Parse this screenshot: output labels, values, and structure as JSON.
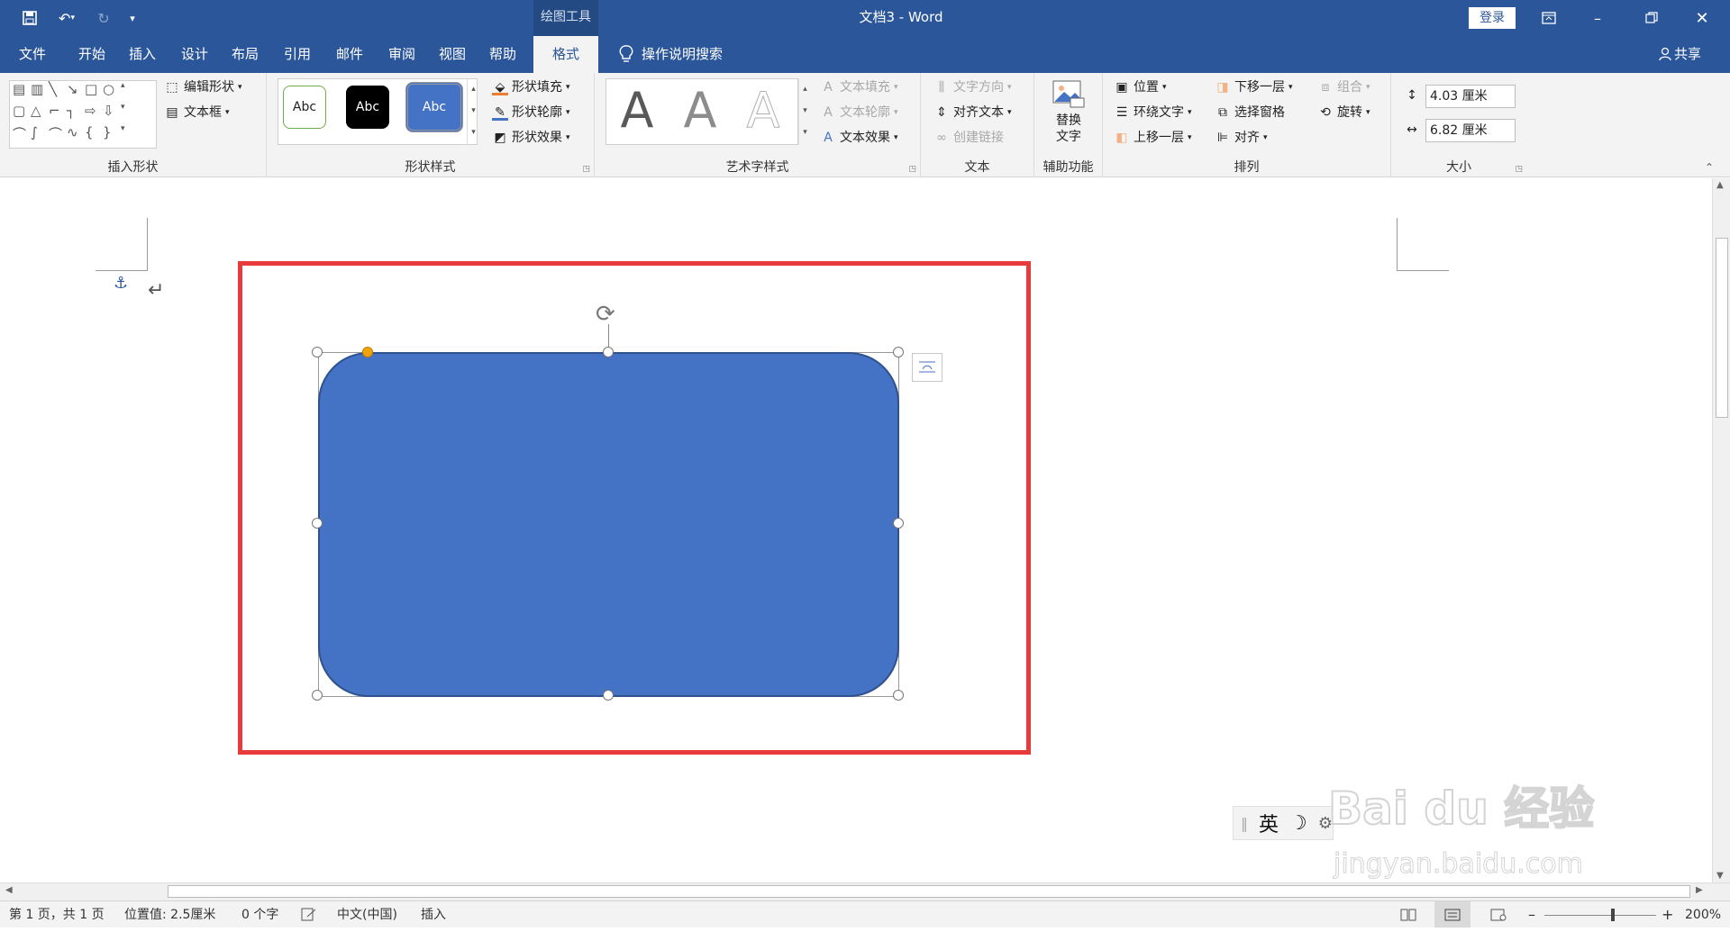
{
  "titlebar": {
    "contextual_tab_group": "绘图工具",
    "document_title": "文档3  -  Word",
    "login_label": "登录"
  },
  "tabs": [
    "文件",
    "开始",
    "插入",
    "设计",
    "布局",
    "引用",
    "邮件",
    "审阅",
    "视图",
    "帮助",
    "格式"
  ],
  "active_tab": "格式",
  "tell_me": "操作说明搜索",
  "share_label": "共享",
  "ribbon": {
    "insert_shapes": {
      "label": "插入形状",
      "edit_shape": "编辑形状",
      "text_box": "文本框"
    },
    "shape_styles": {
      "label": "形状样式",
      "samples": [
        "Abc",
        "Abc",
        "Abc"
      ],
      "fill": "形状填充",
      "outline": "形状轮廓",
      "effects": "形状效果"
    },
    "wordart_styles": {
      "label": "艺术字样式",
      "letters": [
        "A",
        "A",
        "A"
      ],
      "text_fill": "文本填充",
      "text_outline": "文本轮廓",
      "text_effects": "文本效果"
    },
    "text": {
      "label": "文本",
      "direction": "文字方向",
      "align": "对齐文本",
      "link": "创建链接"
    },
    "accessibility": {
      "label": "辅助功能",
      "alt_text_1": "替换",
      "alt_text_2": "文字"
    },
    "arrange": {
      "label": "排列",
      "position": "位置",
      "wrap": "环绕文字",
      "forward": "上移一层",
      "backward": "下移一层",
      "pane": "选择窗格",
      "align": "对齐",
      "group": "组合",
      "rotate": "旋转"
    },
    "size": {
      "label": "大小",
      "height": "4.03 厘米",
      "width": "6.82 厘米"
    }
  },
  "document": {
    "ime_text": "英",
    "ime_moon": "☽"
  },
  "statusbar": {
    "page": "第 1 页，共 1 页",
    "position": "位置值: 2.5厘米",
    "words": "0 个字",
    "language": "中文(中国)",
    "mode": "插入",
    "zoom": "200%"
  },
  "watermark": {
    "brand": "Bai du 经验",
    "url": "jingyan.baidu.com"
  },
  "colors": {
    "accent": "#2b579a",
    "shape_fill": "#4472c4",
    "shape_border": "#2f528f",
    "highlight": "#e8393b"
  }
}
